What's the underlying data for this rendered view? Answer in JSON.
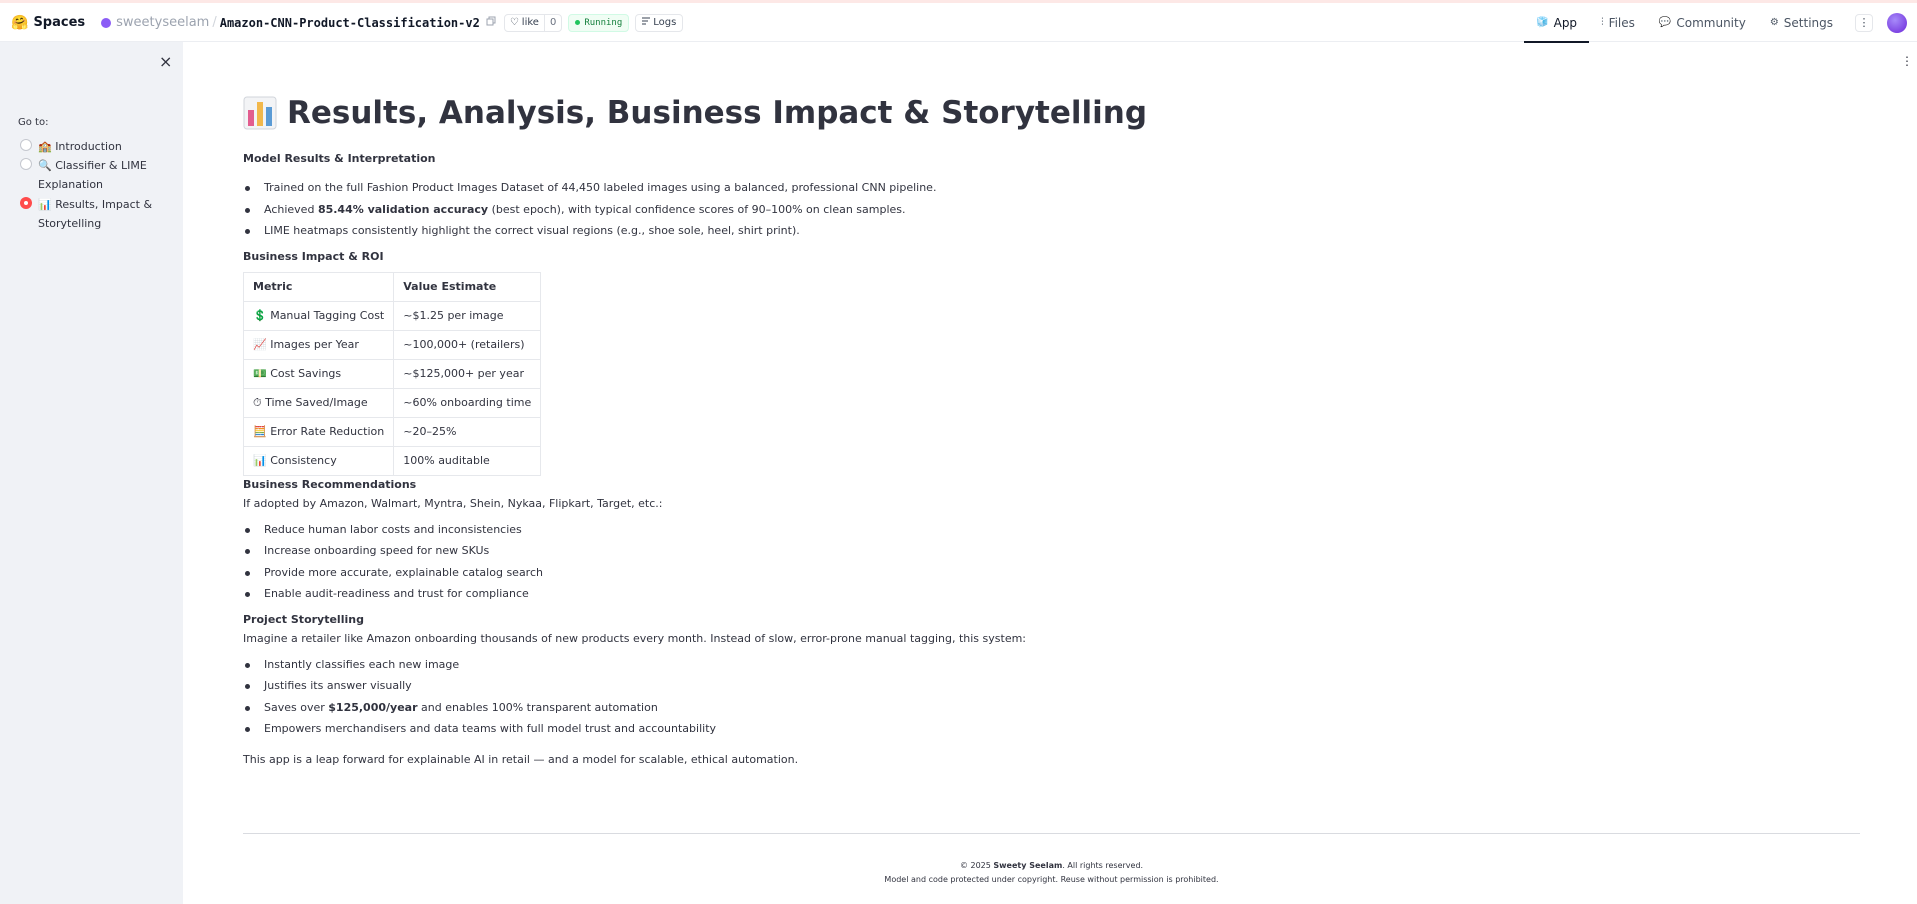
{
  "header": {
    "logo_emoji": "🤗",
    "spaces_label": "Spaces",
    "owner": "sweetyseelam",
    "separator": "/",
    "repo": "Amazon-CNN-Product-Classification-v2",
    "like_label": "like",
    "like_count": "0",
    "status": "Running",
    "logs_label": "Logs",
    "tabs": [
      {
        "label": "App",
        "icon": "🧊"
      },
      {
        "label": "Files",
        "icon": "⫶"
      },
      {
        "label": "Community",
        "icon": "💬"
      },
      {
        "label": "Settings",
        "icon": "⚙"
      }
    ],
    "more_label": "⋮"
  },
  "sidebar": {
    "close_label": "×",
    "goto_label": "Go to:",
    "items": [
      {
        "label": "🏫 Introduction",
        "selected": false
      },
      {
        "label": "🔍 Classifier & LIME Explanation",
        "selected": false
      },
      {
        "label": "📊 Results, Impact & Storytelling",
        "selected": true
      }
    ]
  },
  "main": {
    "kebab": "⋮",
    "title": "Results, Analysis, Business Impact & Storytelling",
    "results_heading": "Model Results & Interpretation",
    "results_bullets": [
      {
        "pre": "Trained on the full Fashion Product Images Dataset of 44,450 labeled images using a balanced, professional CNN pipeline.",
        "bold": "",
        "post": ""
      },
      {
        "pre": "Achieved ",
        "bold": "85.44% validation accuracy",
        "post": " (best epoch), with typical confidence scores of 90–100% on clean samples."
      },
      {
        "pre": "LIME heatmaps consistently highlight the correct visual regions (e.g., shoe sole, heel, shirt print).",
        "bold": "",
        "post": ""
      }
    ],
    "roi_heading": "Business Impact & ROI",
    "roi_table": {
      "headers": [
        "Metric",
        "Value Estimate"
      ],
      "rows": [
        {
          "icon": "💲",
          "metric": "Manual Tagging Cost",
          "value": "~$1.25 per image"
        },
        {
          "icon": "📈",
          "metric": "Images per Year",
          "value": "~100,000+ (retailers)"
        },
        {
          "icon": "💵",
          "metric": "Cost Savings",
          "value": "~$125,000+ per year"
        },
        {
          "icon": "⏱",
          "metric": "Time Saved/Image",
          "value": "~60% onboarding time"
        },
        {
          "icon": "🧮",
          "metric": "Error Rate Reduction",
          "value": "~20–25%"
        },
        {
          "icon": "📊",
          "metric": "Consistency",
          "value": "100% auditable"
        }
      ]
    },
    "recs_heading": "Business Recommendations",
    "recs_intro": "If adopted by Amazon, Walmart, Myntra, Shein, Nykaa, Flipkart, Target, etc.:",
    "recs_bullets": [
      "Reduce human labor costs and inconsistencies",
      "Increase onboarding speed for new SKUs",
      "Provide more accurate, explainable catalog search",
      "Enable audit-readiness and trust for compliance"
    ],
    "story_heading": "Project Storytelling",
    "story_intro": "Imagine a retailer like Amazon onboarding thousands of new products every month. Instead of slow, error-prone manual tagging, this system:",
    "story_bullets": [
      {
        "pre": "Instantly classifies each new image",
        "bold": "",
        "post": ""
      },
      {
        "pre": "Justifies its answer visually",
        "bold": "",
        "post": ""
      },
      {
        "pre": "Saves over ",
        "bold": "$125,000/year",
        "post": " and enables 100% transparent automation"
      },
      {
        "pre": "Empowers merchandisers and data teams with full model trust and accountability",
        "bold": "",
        "post": ""
      }
    ],
    "closing": "This app is a leap forward for explainable AI in retail — and a model for scalable, ethical automation."
  },
  "footer": {
    "copyright_pre": "© 2025 ",
    "copyright_name": "Sweety Seelam",
    "copyright_post": ". All rights reserved.",
    "notice": "Model and code protected under copyright. Reuse without permission is prohibited."
  }
}
